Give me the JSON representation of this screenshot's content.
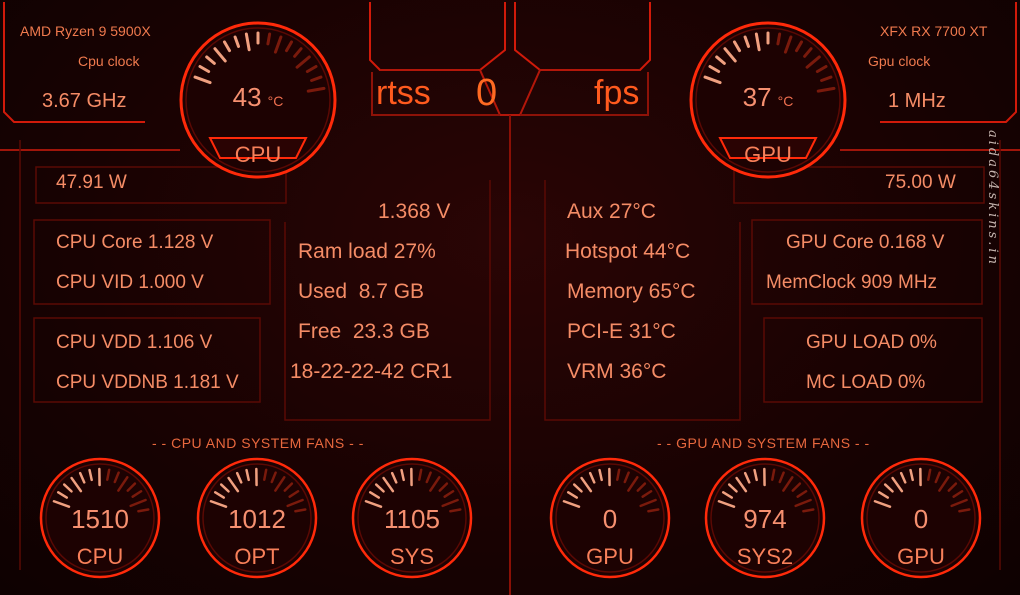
{
  "cpu": {
    "name": "AMD Ryzen 9 5900X",
    "clock_label": "Cpu clock",
    "clock_value": "3.67 GHz",
    "temp": "43",
    "temp_unit": "°C",
    "gauge_label": "CPU",
    "power": "47.91 W",
    "core_voltage": "CPU Core 1.128 V",
    "vid": "CPU VID 1.000 V",
    "vdd": "CPU VDD 1.106 V",
    "vddnb": "CPU VDDNB 1.181 V"
  },
  "gpu": {
    "name": "XFX RX 7700 XT",
    "clock_label": "Gpu clock",
    "clock_value": "1 MHz",
    "temp": "37",
    "temp_unit": "°C",
    "gauge_label": "GPU",
    "power": "75.00 W",
    "core_voltage": "GPU Core 0.168 V",
    "memclock": "MemClock 909 MHz",
    "load": "GPU LOAD 0%",
    "mc_load": "MC LOAD 0%"
  },
  "rtss": {
    "left": "rtss",
    "value": "0",
    "right": "fps"
  },
  "ram": {
    "voltage": "1.368 V",
    "load": "Ram load 27%",
    "used": "Used  8.7 GB",
    "free": "Free  23.3 GB",
    "timings": "18-22-22-42 CR1"
  },
  "temps": {
    "aux": "Aux 27°C",
    "hotspot": "Hotspot 44°C",
    "memory": "Memory 65°C",
    "pcie": "PCI-E 31°C",
    "vrm": "VRM 36°C"
  },
  "cpu_fans": {
    "heading": "- - CPU AND SYSTEM FANS - -",
    "fans": [
      {
        "value": "1510",
        "label": "CPU"
      },
      {
        "value": "1012",
        "label": "OPT"
      },
      {
        "value": "1105",
        "label": "SYS"
      }
    ]
  },
  "gpu_fans": {
    "heading": "- - GPU AND SYSTEM FANS - -",
    "fans": [
      {
        "value": "0",
        "label": "GPU"
      },
      {
        "value": "974",
        "label": "SYS2"
      },
      {
        "value": "0",
        "label": "GPU"
      }
    ]
  },
  "watermark": "aida64skins.in",
  "colors": {
    "accent": "#ff2a0a",
    "text": "#f38a62",
    "background": "#1a0303"
  }
}
